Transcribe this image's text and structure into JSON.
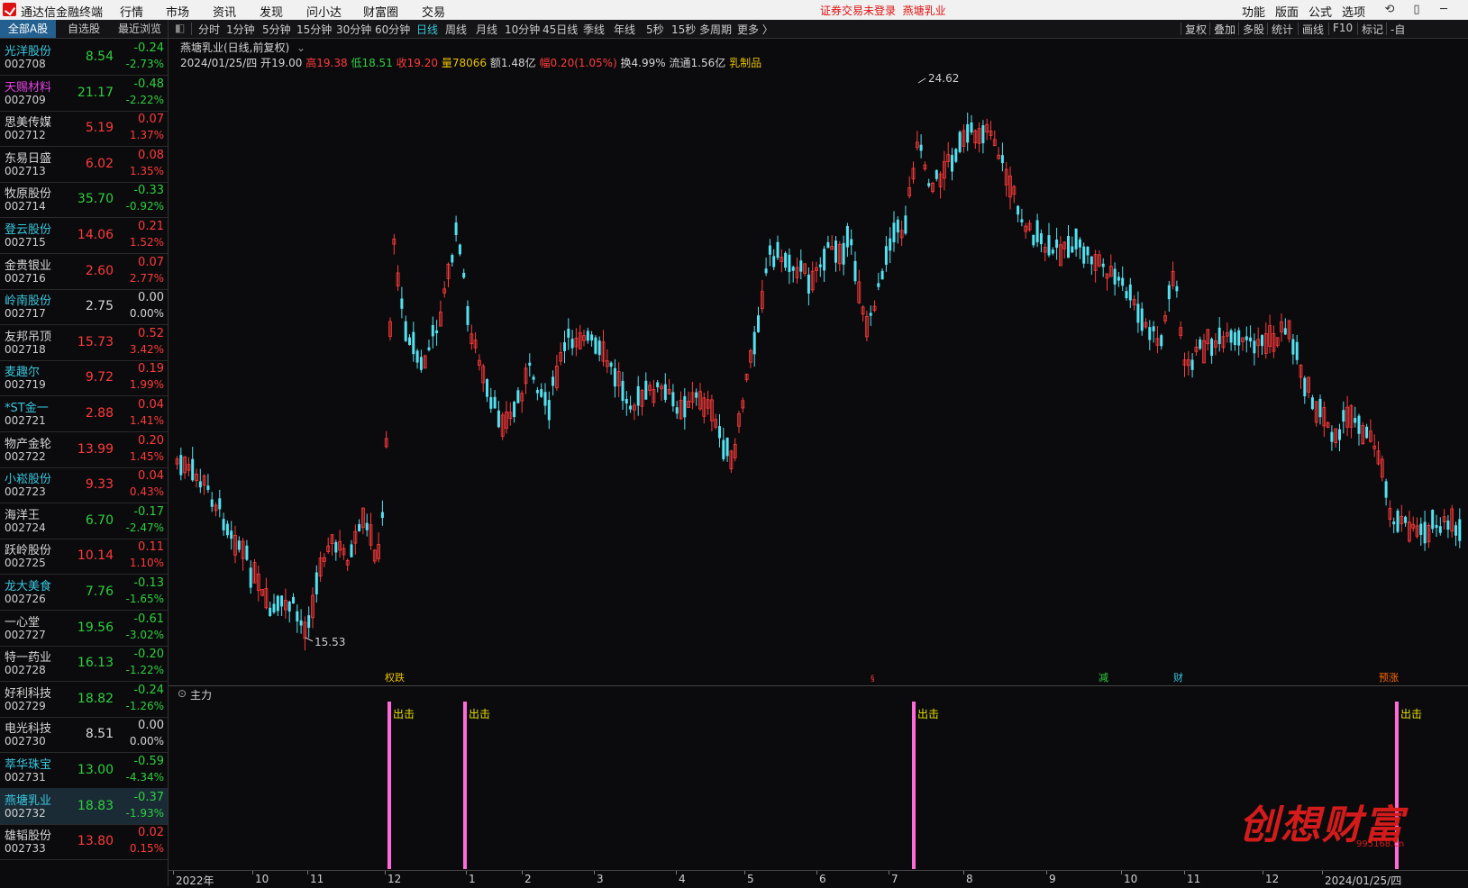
{
  "app": {
    "name": "通达信金融终端",
    "menu": [
      "行情",
      "市场",
      "资讯",
      "发现",
      "问小达",
      "财富圈",
      "交易"
    ],
    "notice": "证券交易未登录",
    "current_stock": "燕塘乳业",
    "right_menu": [
      "功能",
      "版面",
      "公式",
      "选项"
    ]
  },
  "left_tabs": [
    "全部A股",
    "自选股",
    "最近浏览"
  ],
  "stocks": [
    {
      "name": "光洋股份",
      "code": "002708",
      "price": "8.54",
      "change": "-0.24",
      "pct": "-2.73%",
      "name_color": "cyan",
      "dir": "dn"
    },
    {
      "name": "天赐材料",
      "code": "002709",
      "price": "21.17",
      "change": "-0.48",
      "pct": "-2.22%",
      "name_color": "magenta",
      "dir": "dn"
    },
    {
      "name": "思美传媒",
      "code": "002712",
      "price": "5.19",
      "change": "0.07",
      "pct": "1.37%",
      "name_color": "white",
      "dir": "up"
    },
    {
      "name": "东易日盛",
      "code": "002713",
      "price": "6.02",
      "change": "0.08",
      "pct": "1.35%",
      "name_color": "white",
      "dir": "up"
    },
    {
      "name": "牧原股份",
      "code": "002714",
      "price": "35.70",
      "change": "-0.33",
      "pct": "-0.92%",
      "name_color": "white",
      "dir": "dn"
    },
    {
      "name": "登云股份",
      "code": "002715",
      "price": "14.06",
      "change": "0.21",
      "pct": "1.52%",
      "name_color": "cyan",
      "dir": "up"
    },
    {
      "name": "金贵银业",
      "code": "002716",
      "price": "2.60",
      "change": "0.07",
      "pct": "2.77%",
      "name_color": "white",
      "dir": "up"
    },
    {
      "name": "岭南股份",
      "code": "002717",
      "price": "2.75",
      "change": "0.00",
      "pct": "0.00%",
      "name_color": "cyan",
      "dir": "fl"
    },
    {
      "name": "友邦吊顶",
      "code": "002718",
      "price": "15.73",
      "change": "0.52",
      "pct": "3.42%",
      "name_color": "white",
      "dir": "up"
    },
    {
      "name": "麦趣尔",
      "code": "002719",
      "price": "9.72",
      "change": "0.19",
      "pct": "1.99%",
      "name_color": "cyan",
      "dir": "up"
    },
    {
      "name": "*ST金一",
      "code": "002721",
      "price": "2.88",
      "change": "0.04",
      "pct": "1.41%",
      "name_color": "cyan",
      "dir": "up"
    },
    {
      "name": "物产金轮",
      "code": "002722",
      "price": "13.99",
      "change": "0.20",
      "pct": "1.45%",
      "name_color": "white",
      "dir": "up"
    },
    {
      "name": "小崧股份",
      "code": "002723",
      "price": "9.33",
      "change": "0.04",
      "pct": "0.43%",
      "name_color": "cyan",
      "dir": "up"
    },
    {
      "name": "海洋王",
      "code": "002724",
      "price": "6.70",
      "change": "-0.17",
      "pct": "-2.47%",
      "name_color": "white",
      "dir": "dn"
    },
    {
      "name": "跃岭股份",
      "code": "002725",
      "price": "10.14",
      "change": "0.11",
      "pct": "1.10%",
      "name_color": "white",
      "dir": "up"
    },
    {
      "name": "龙大美食",
      "code": "002726",
      "price": "7.76",
      "change": "-0.13",
      "pct": "-1.65%",
      "name_color": "cyan",
      "dir": "dn"
    },
    {
      "name": "一心堂",
      "code": "002727",
      "price": "19.56",
      "change": "-0.61",
      "pct": "-3.02%",
      "name_color": "white",
      "dir": "dn"
    },
    {
      "name": "特一药业",
      "code": "002728",
      "price": "16.13",
      "change": "-0.20",
      "pct": "-1.22%",
      "name_color": "white",
      "dir": "dn"
    },
    {
      "name": "好利科技",
      "code": "002729",
      "price": "18.82",
      "change": "-0.24",
      "pct": "-1.26%",
      "name_color": "white",
      "dir": "dn"
    },
    {
      "name": "电光科技",
      "code": "002730",
      "price": "8.51",
      "change": "0.00",
      "pct": "0.00%",
      "name_color": "white",
      "dir": "fl"
    },
    {
      "name": "萃华珠宝",
      "code": "002731",
      "price": "13.00",
      "change": "-0.59",
      "pct": "-4.34%",
      "name_color": "cyan",
      "dir": "dn"
    },
    {
      "name": "燕塘乳业",
      "code": "002732",
      "price": "18.83",
      "change": "-0.37",
      "pct": "-1.93%",
      "name_color": "cyan",
      "dir": "dn"
    },
    {
      "name": "雄韬股份",
      "code": "002733",
      "price": "13.80",
      "change": "0.02",
      "pct": "0.15%",
      "name_color": "white",
      "dir": "up"
    }
  ],
  "periods": [
    "分时",
    "1分钟",
    "5分钟",
    "15分钟",
    "30分钟",
    "60分钟",
    "日线",
    "周线",
    "月线",
    "10分钟",
    "45日线",
    "季线",
    "年线",
    "5秒",
    "15秒",
    "多周期",
    "更多 〉"
  ],
  "active_period": "日线",
  "right_tools": [
    "复权",
    "叠加",
    "多股",
    "统计",
    "画线",
    "F10",
    "标记",
    "-自"
  ],
  "chart_header": {
    "title": "燕塘乳业(日线,前复权)",
    "date": "2024/01/25/四",
    "open_label": "开",
    "open": "19.00",
    "high_label": "高",
    "high": "19.38",
    "low_label": "低",
    "low": "18.51",
    "close_label": "收",
    "close": "19.20",
    "vol_label": "量",
    "vol": "78066",
    "amt_label": "额",
    "amt": "1.48亿",
    "chg_label": "幅",
    "chg": "0.20(1.05%)",
    "turn_label": "换",
    "turn": "4.99%",
    "float_label": "流通",
    "float": "1.56亿",
    "industry": "乳制品"
  },
  "chart_data": {
    "type": "candlestick",
    "high_label": "24.62",
    "low_label": "15.53",
    "markers": [
      "权跌",
      "",
      "减",
      "财",
      "预涨"
    ],
    "colors": {
      "up": "#ff3b3b",
      "down": "#54e2f2",
      "signal": "#ff6ad9"
    }
  },
  "subchart": {
    "title": "主力",
    "signal_label": "出击",
    "signal_count": 4
  },
  "date_axis": [
    "2022年",
    "10",
    "11",
    "12",
    "1",
    "2",
    "3",
    "4",
    "5",
    "6",
    "7",
    "8",
    "9",
    "10",
    "11",
    "12",
    "2024/01/25/四"
  ],
  "watermark": {
    "text": "创想财富",
    "url": "995168.cn"
  }
}
